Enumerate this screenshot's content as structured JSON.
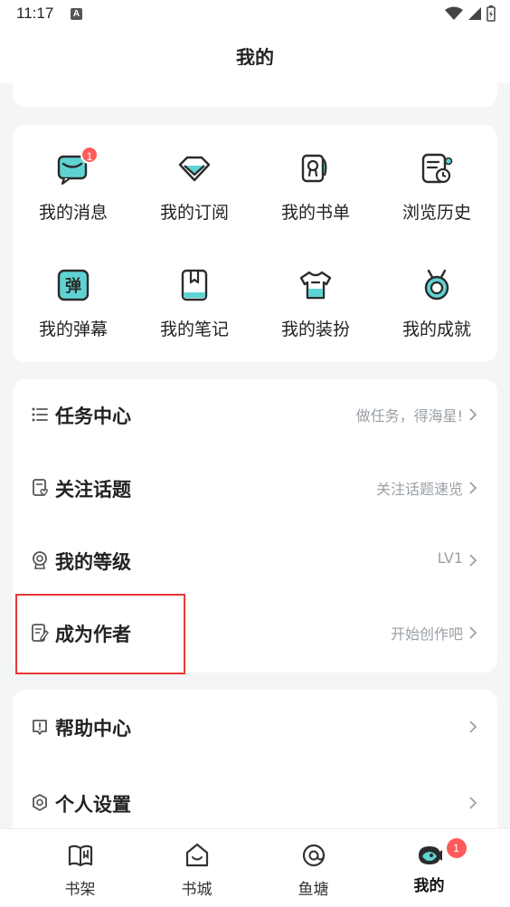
{
  "status_bar": {
    "time": "11:17",
    "notification_glyph": "A"
  },
  "header": {
    "title": "我的"
  },
  "grid": {
    "items": [
      {
        "label": "我的消息",
        "icon": "message-icon",
        "badge": "1"
      },
      {
        "label": "我的订阅",
        "icon": "diamond-icon"
      },
      {
        "label": "我的书单",
        "icon": "booklist-icon"
      },
      {
        "label": "浏览历史",
        "icon": "history-icon"
      },
      {
        "label": "我的弹幕",
        "icon": "danmaku-icon",
        "glyph": "弹"
      },
      {
        "label": "我的笔记",
        "icon": "notes-icon"
      },
      {
        "label": "我的装扮",
        "icon": "tshirt-icon"
      },
      {
        "label": "我的成就",
        "icon": "medal-icon"
      }
    ]
  },
  "list1": {
    "rows": [
      {
        "title": "任务中心",
        "hint": "做任务，得海星!",
        "icon": "task-list-icon"
      },
      {
        "title": "关注话题",
        "hint": "关注话题速览",
        "icon": "topic-icon"
      },
      {
        "title": "我的等级",
        "hint": "LV1",
        "icon": "level-icon"
      },
      {
        "title": "成为作者",
        "hint": "开始创作吧",
        "icon": "write-icon"
      }
    ]
  },
  "list2": {
    "rows": [
      {
        "title": "帮助中心",
        "hint": "",
        "icon": "help-icon"
      },
      {
        "title": "个人设置",
        "hint": "",
        "icon": "settings-icon"
      }
    ]
  },
  "tabbar": {
    "tabs": [
      {
        "label": "书架",
        "icon": "bookshelf-icon"
      },
      {
        "label": "书城",
        "icon": "bookstore-icon"
      },
      {
        "label": "鱼塘",
        "icon": "fishpond-icon"
      },
      {
        "label": "我的",
        "icon": "profile-icon",
        "badge": "1",
        "active": true
      }
    ]
  },
  "colors": {
    "accent_teal": "#5fd3d3",
    "icon_dark": "#2b2b2b",
    "badge_red": "#ff5a5a",
    "highlight_red": "#e53935"
  }
}
